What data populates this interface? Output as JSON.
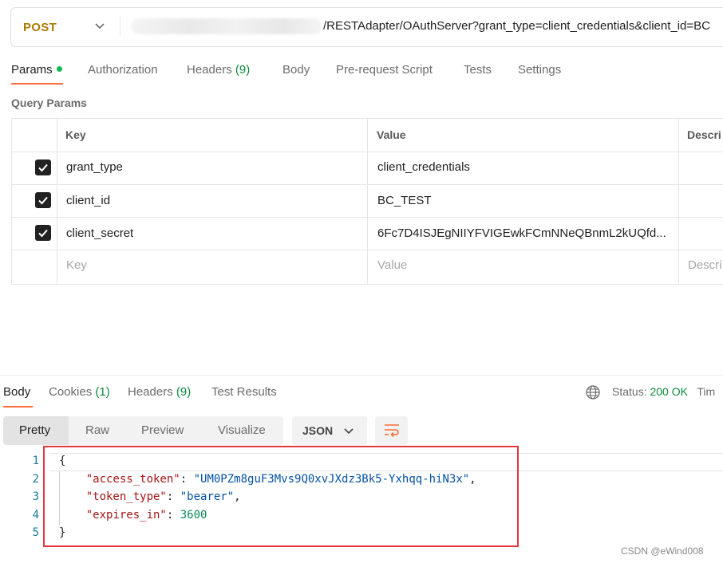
{
  "request": {
    "method": "POST",
    "url_visible": "/RESTAdapter/OAuthServer?grant_type=client_credentials&client_id=BC"
  },
  "request_tabs": [
    {
      "label": "Params",
      "active": true
    },
    {
      "label": "Authorization"
    },
    {
      "label": "Headers",
      "count": "(9)"
    },
    {
      "label": "Body"
    },
    {
      "label": "Pre-request Script"
    },
    {
      "label": "Tests"
    },
    {
      "label": "Settings"
    }
  ],
  "query_params": {
    "title": "Query Params",
    "headers": [
      "Key",
      "Value",
      "Descri"
    ],
    "rows": [
      {
        "checked": true,
        "key": "grant_type",
        "value": "client_credentials"
      },
      {
        "checked": true,
        "key": "client_id",
        "value": "BC_TEST"
      },
      {
        "checked": true,
        "key": "client_secret",
        "value": "6Fc7D4ISJEgNIIYFVIGEwkFCmNNeQBnmL2kUQfd..."
      }
    ],
    "placeholder": {
      "key": "Key",
      "value": "Value",
      "description": "Descri"
    }
  },
  "response_tabs": [
    {
      "label": "Body",
      "active": true
    },
    {
      "label": "Cookies",
      "count": "(1)"
    },
    {
      "label": "Headers",
      "count": "(9)"
    },
    {
      "label": "Test Results"
    }
  ],
  "status": {
    "label": "Status:",
    "value": "200 OK",
    "time_label": "Tim"
  },
  "view_modes": [
    "Pretty",
    "Raw",
    "Preview",
    "Visualize"
  ],
  "format": "JSON",
  "body": {
    "line_numbers": [
      "1",
      "2",
      "3",
      "4",
      "5"
    ],
    "open_brace": "{",
    "close_brace": "}",
    "fields": [
      {
        "key": "\"access_token\"",
        "value": "\"UM0PZm8guF3Mvs9Q0xvJXdz3Bk5-Yxhqq-hiN3x\"",
        "comma": ",",
        "type": "string"
      },
      {
        "key": "\"token_type\"",
        "value": "\"bearer\"",
        "comma": ",",
        "type": "string"
      },
      {
        "key": "\"expires_in\"",
        "value": "3600",
        "comma": "",
        "type": "number"
      }
    ]
  },
  "watermark": "CSDN @eWind008",
  "icons": {
    "method_dropdown": "chevron-down-icon",
    "format_dropdown": "chevron-down-icon",
    "wrap": "wrap-lines-icon",
    "globe": "globe-icon",
    "checkbox": "checkmark-icon"
  },
  "colors": {
    "accent": "#ff6c37",
    "method": "#ad7a03",
    "ok": "#0b8a3a",
    "highlight_box": "#e5373f"
  }
}
